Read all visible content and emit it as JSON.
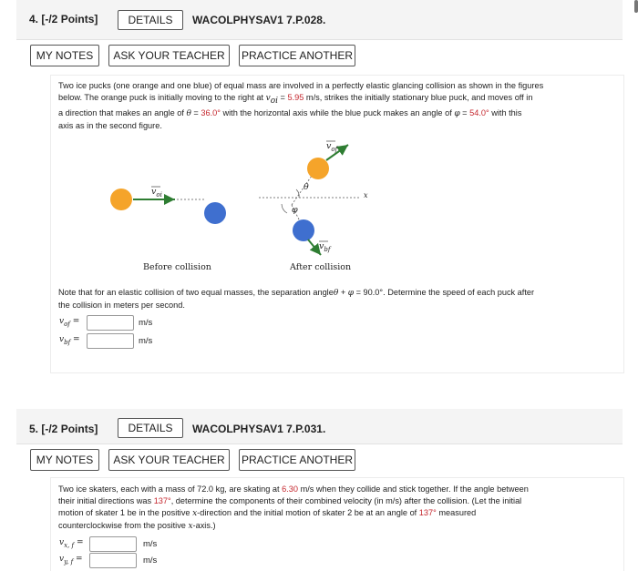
{
  "q4": {
    "number": "4.",
    "points": "[-/2 Points]",
    "details": "DETAILS",
    "code": "WACOLPHYSAV1 7.P.028.",
    "my_notes": "MY NOTES",
    "ask": "ASK YOUR TEACHER",
    "another": "PRACTICE ANOTHER",
    "p1a": "Two ice pucks (one orange and one blue) of equal mass are involved in a perfectly elastic glancing collision as shown in the figures",
    "p1b_pre": "below. The orange puck is initially moving to the right at ",
    "p1b_var": "v",
    "p1b_sub": "oi",
    "p1b_eq": " = ",
    "p1b_val": "5.95",
    "p1b_post": " m/s, strikes the initially stationary blue puck, and moves off in",
    "p1c_pre": "a direction that makes an angle of ",
    "p1c_theta": "θ",
    "p1c_eq": " = ",
    "p1c_val": "36.0°",
    "p1c_mid": " with the horizontal axis while the blue puck makes an angle of ",
    "p1c_phi": "φ",
    "p1c_eq2": " = ",
    "p1c_val2": "54.0°",
    "p1c_post": " with this",
    "p1d": "axis as in the second figure.",
    "fig": {
      "v_oi": "v",
      "v_oi_sub": "oi",
      "v_of": "v",
      "v_of_sub": "of",
      "v_bf": "v",
      "v_bf_sub": "bf",
      "theta": "θ",
      "phi": "φ",
      "x": "x",
      "before": "Before collision",
      "after": "After collision"
    },
    "note1_pre": "Note that for an elastic collision of two equal masses, the separation angle",
    "note1_theta": "θ",
    "note1_plus": " + ",
    "note1_phi": "φ",
    "note1_eq": " = 90.0°. Determine the speed of each puck after",
    "note2": "the collision in meters per second.",
    "ans1_var": "v",
    "ans1_sub": "of",
    "ans1_eq": " =",
    "ans1_unit": "m/s",
    "ans2_var": "v",
    "ans2_sub": "bf",
    "ans2_eq": " =",
    "ans2_unit": "m/s"
  },
  "q5": {
    "number": "5.",
    "points": "[-/2 Points]",
    "details": "DETAILS",
    "code": "WACOLPHYSAV1 7.P.031.",
    "my_notes": "MY NOTES",
    "ask": "ASK YOUR TEACHER",
    "another": "PRACTICE ANOTHER",
    "p1a_pre": "Two ice skaters, each with a mass of 72.0 kg, are skating at ",
    "p1a_val": "6.30",
    "p1a_post": " m/s when they collide and stick together. If the angle between",
    "p1b_pre": "their initial directions was ",
    "p1b_val": "137°",
    "p1b_post": ", determine the components of their combined velocity (in m/s) after the collision. (Let the initial",
    "p1c_pre": "motion of skater 1 be in the positive ",
    "p1c_x": "x",
    "p1c_post": "-direction and the initial motion of skater 2 be at an angle of ",
    "p1c_val": "137°",
    "p1c_end": " measured",
    "p1d_pre": "counterclockwise from the positive ",
    "p1d_x": "x",
    "p1d_post": "-axis.)",
    "ans1_var": "v",
    "ans1_sub": "x, f",
    "ans1_eq": " =",
    "ans1_unit": "m/s",
    "ans2_var": "v",
    "ans2_sub": "y, f",
    "ans2_eq": " =",
    "ans2_unit": "m/s"
  },
  "colors": {
    "orange": "#f5a42a",
    "blue": "#3f6fcf",
    "arrow": "#2e7d32",
    "red_value": "#c5282f"
  }
}
